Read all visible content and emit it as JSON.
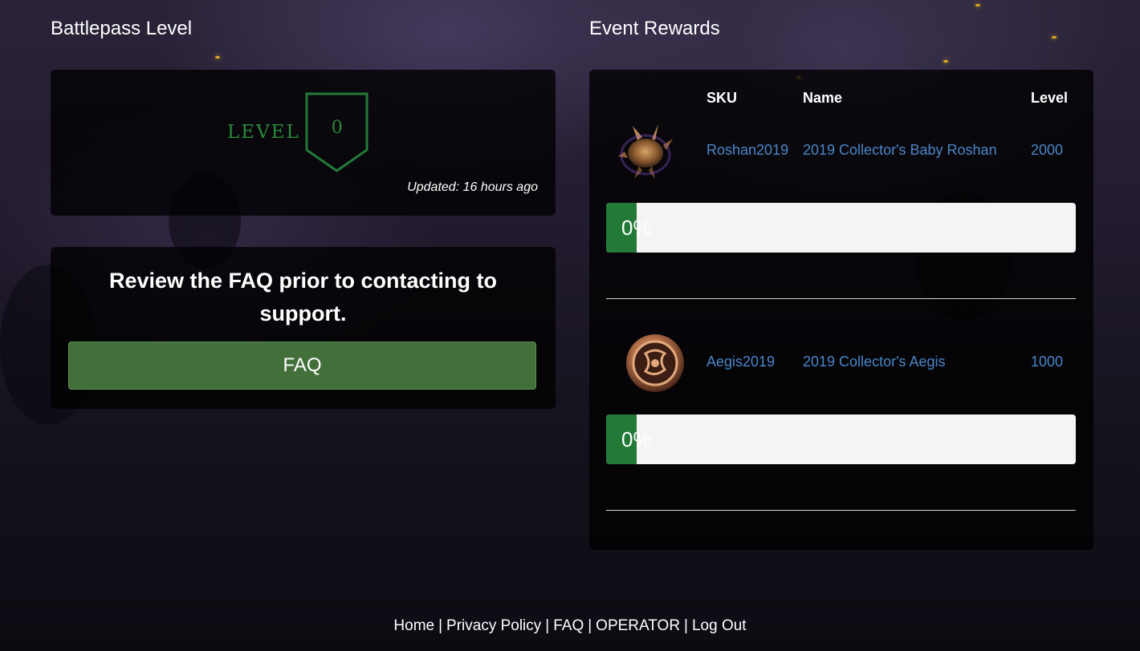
{
  "battlepass": {
    "heading": "Battlepass Level",
    "level_word": "LEVEL",
    "level_value": "0",
    "updated": "Updated: 16 hours ago"
  },
  "faq_panel": {
    "text": "Review the FAQ prior to contacting to support.",
    "button_label": "FAQ"
  },
  "rewards": {
    "heading": "Event Rewards",
    "columns": [
      "SKU",
      "Name",
      "Level"
    ],
    "items": [
      {
        "sku": "Roshan2019",
        "name": "2019 Collector's Baby Roshan",
        "level": "2000",
        "progress_label": "0%",
        "progress": 0,
        "icon": "baby-roshan-icon"
      },
      {
        "sku": "Aegis2019",
        "name": "2019 Collector's Aegis",
        "level": "1000",
        "progress_label": "0%",
        "progress": 0,
        "icon": "aegis-icon"
      }
    ]
  },
  "footer": {
    "links": [
      "Home",
      "Privacy Policy",
      "FAQ",
      "OPERATOR",
      "Log Out"
    ],
    "separator": "|"
  },
  "colors": {
    "accent_green": "#2a8a3a",
    "button_green": "#43703a",
    "link_blue": "#4a86c8",
    "progress_fill": "#237a37"
  }
}
